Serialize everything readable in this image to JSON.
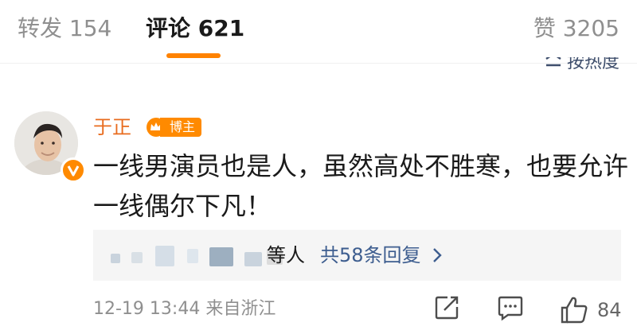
{
  "tabs": {
    "repost": "转发 154",
    "comment": "评论 621",
    "like": "赞 3205"
  },
  "sort": {
    "label": "按热度"
  },
  "comment": {
    "username": "于正",
    "badge": "博主",
    "text_lines": [
      "一线男演员也是人，虽然高处不胜寒，也要允许",
      "一线偶尔下凡！"
    ],
    "replies": {
      "who_suffix": "等人",
      "count_label": "共58条回复"
    },
    "meta": "12-19 13:44 来自浙江",
    "like_count": "84"
  },
  "colors": {
    "accent": "#ff8200",
    "username": "#e86b1e",
    "link": "#3d5d8f",
    "muted": "#8f8f8f"
  },
  "icons": [
    "sort-icon",
    "v-badge-icon",
    "crown-icon",
    "chevron-right-icon",
    "share-icon",
    "comment-icon",
    "like-icon"
  ]
}
